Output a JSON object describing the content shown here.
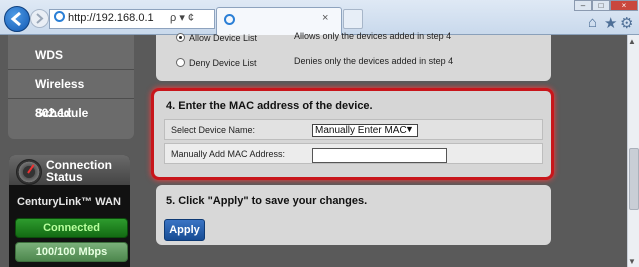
{
  "browser": {
    "address_url": "http://192.168.0.1",
    "address_controls": "ρ ▾ ¢",
    "tab_close": "×",
    "window_buttons": {
      "minimize": "–",
      "maximize": "□",
      "close": "×"
    }
  },
  "sidebar": {
    "items": [
      {
        "label": "WDS"
      },
      {
        "label": "Wireless Schedule"
      },
      {
        "label": "802.1x"
      }
    ],
    "connection": {
      "title": "Connection Status",
      "wan_label": "CenturyLink™ WAN",
      "status": "Connected",
      "speed": "100/100 Mbps"
    }
  },
  "step3": {
    "options": [
      {
        "label": "Allow Device List",
        "description": "Allows only the devices added in step 4",
        "selected": true
      },
      {
        "label": "Deny Device List",
        "description": "Denies only the devices added in step 4",
        "selected": false
      }
    ]
  },
  "step4": {
    "title": "4. Enter the MAC address of the device.",
    "select_label": "Select Device Name:",
    "select_value": "Manually Enter MAC",
    "mac_label": "Manually Add MAC Address:",
    "mac_value": ""
  },
  "step5": {
    "title": "5. Click \"Apply\" to save your changes.",
    "apply_label": "Apply"
  },
  "colors": {
    "highlight_border": "#c8161b",
    "apply_button": "#1f5aa8",
    "connected_green": "#2e9b2e"
  }
}
